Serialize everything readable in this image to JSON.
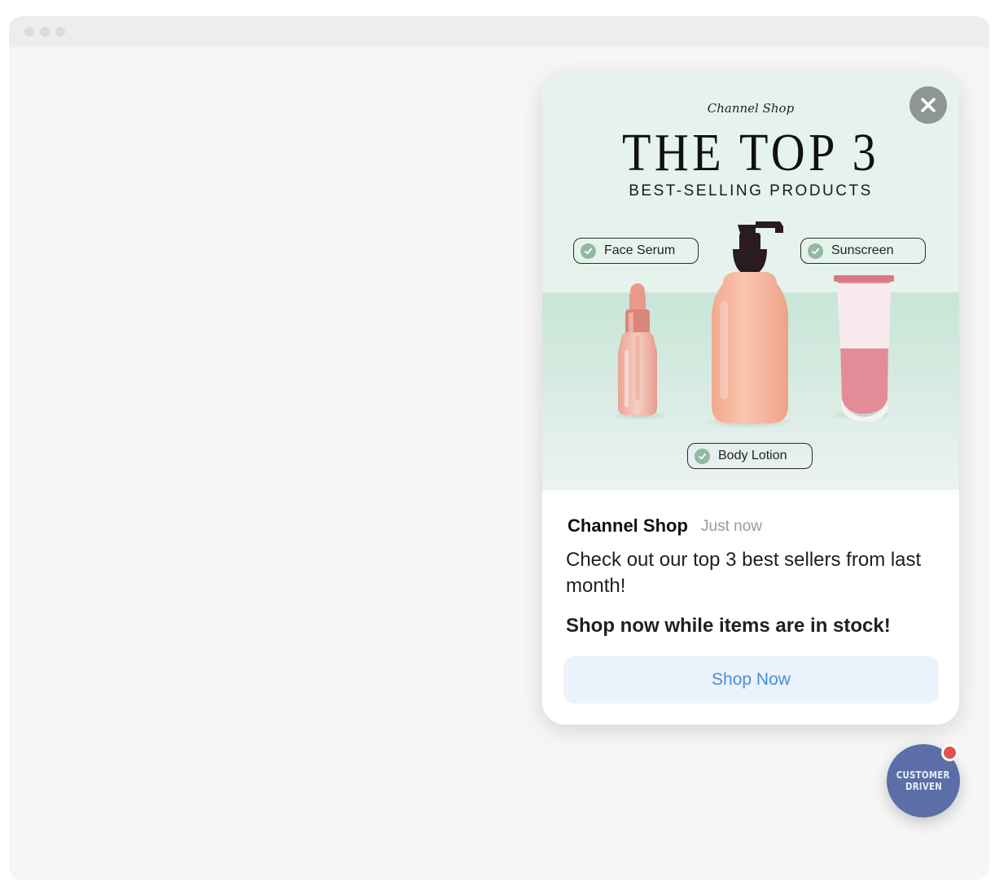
{
  "popup": {
    "hero": {
      "brand": "Channel Shop",
      "title": "THE TOP 3",
      "subtitle": "BEST-SELLING PRODUCTS",
      "products": [
        "Face Serum",
        "Sunscreen",
        "Body Lotion"
      ]
    },
    "sender": "Channel Shop",
    "time": "Just now",
    "message": "Check out our top 3 best sellers from last month!",
    "cta_text": "Shop now while items are in stock!",
    "button_label": "Shop Now"
  },
  "launcher": {
    "logo_lines": [
      "CUSTOMER",
      "DRIVEN"
    ],
    "has_notification": true
  },
  "colors": {
    "accent": "#4a8fd6",
    "button_bg": "#eaf2fb",
    "launcher": "#5b6ea8",
    "badge": "#e0514f"
  }
}
